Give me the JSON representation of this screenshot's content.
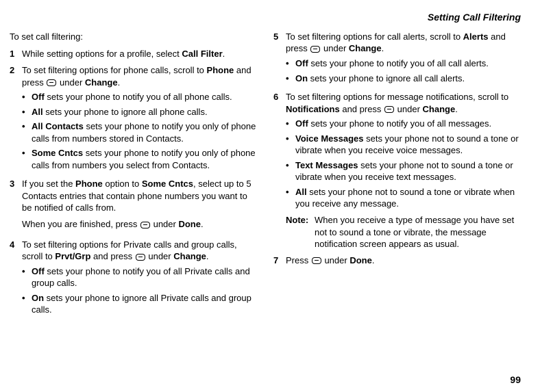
{
  "header": "Setting Call Filtering",
  "intro": "To set call filtering:",
  "page_number": "99",
  "col1": {
    "items": [
      {
        "num": "1",
        "text_pre": "While setting options for a profile, select ",
        "bold1": "Call Filter",
        "text_post": "."
      },
      {
        "num": "2",
        "text_pre": "To set filtering options for phone calls, scroll to ",
        "bold1": "Phone",
        "text_mid1": " and press ",
        "text_mid2": " under ",
        "bold2": "Change",
        "text_post": ".",
        "subs": [
          {
            "bold": "Off",
            "rest": " sets your phone to notify you of all phone calls."
          },
          {
            "bold": "All",
            "rest": " sets your phone to ignore all phone calls."
          },
          {
            "bold": "All Contacts",
            "rest": " sets your phone to notify you only of phone calls from numbers stored in Contacts."
          },
          {
            "bold": "Some Cntcs",
            "rest": " sets your phone to notify you only of phone calls from numbers you select from Contacts."
          }
        ]
      },
      {
        "num": "3",
        "text_pre": "If you set the ",
        "bold1": "Phone",
        "text_mid1": " option to ",
        "bold2": "Some Cntcs",
        "text_post": ", select up to 5 Contacts entries that contain phone numbers you want to be notified of calls from.",
        "para_pre": "When you are finished, press ",
        "para_mid": " under ",
        "para_bold": "Done",
        "para_post": "."
      },
      {
        "num": "4",
        "text_pre": "To set filtering options for Private calls and group calls, scroll to ",
        "bold1": "Prvt/Grp",
        "text_mid1": " and press ",
        "text_mid2": " under ",
        "bold2": "Change",
        "text_post": ".",
        "subs": [
          {
            "bold": "Off",
            "rest": " sets your phone to notify you of all Private calls and group calls."
          },
          {
            "bold": "On",
            "rest": " sets your phone to ignore all Private calls and group calls."
          }
        ]
      }
    ]
  },
  "col2": {
    "items": [
      {
        "num": "5",
        "text_pre": "To set filtering options for call alerts, scroll to ",
        "bold1": "Alerts",
        "text_mid1": " and press ",
        "text_mid2": " under ",
        "bold2": "Change",
        "text_post": ".",
        "subs": [
          {
            "bold": "Off",
            "rest": " sets your phone to notify you of all call alerts."
          },
          {
            "bold": "On",
            "rest": " sets your phone to ignore all call alerts."
          }
        ]
      },
      {
        "num": "6",
        "text_pre": "To set filtering options for message notifications, scroll to ",
        "bold1": "Notifications",
        "text_mid1": " and press ",
        "text_mid2": " under ",
        "bold2": "Change",
        "text_post": ".",
        "subs": [
          {
            "bold": "Off",
            "rest": " sets your phone to notify you of all messages."
          },
          {
            "bold": "Voice Messages",
            "rest": " sets your phone not to sound a tone or vibrate when you receive voice messages."
          },
          {
            "bold": "Text Messages",
            "rest": " sets your phone not to sound a tone or vibrate when you receive text messages."
          },
          {
            "bold": "All",
            "rest": " sets your phone not to sound a tone or vibrate when you receive any message."
          }
        ],
        "note_label": "Note:",
        "note_body": "When you receive a type of message you have set not to sound a tone or vibrate, the message notification screen appears as usual."
      },
      {
        "num": "7",
        "text_pre": "Press ",
        "text_mid2": " under ",
        "bold2": "Done",
        "text_post": "."
      }
    ]
  }
}
